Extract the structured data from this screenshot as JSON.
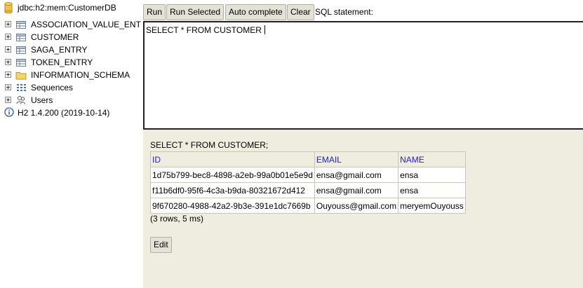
{
  "tree": {
    "connection": "jdbc:h2:mem:CustomerDB",
    "items": [
      {
        "label": "ASSOCIATION_VALUE_ENT",
        "icon": "table-icon"
      },
      {
        "label": "CUSTOMER",
        "icon": "table-icon"
      },
      {
        "label": "SAGA_ENTRY",
        "icon": "table-icon"
      },
      {
        "label": "TOKEN_ENTRY",
        "icon": "table-icon"
      },
      {
        "label": "INFORMATION_SCHEMA",
        "icon": "folder-icon"
      },
      {
        "label": "Sequences",
        "icon": "sequences-icon"
      },
      {
        "label": "Users",
        "icon": "users-icon"
      }
    ],
    "version": "H2 1.4.200 (2019-10-14)"
  },
  "toolbar": {
    "run": "Run",
    "run_selected": "Run Selected",
    "auto_complete": "Auto complete",
    "clear": "Clear",
    "sql_label": "SQL statement:"
  },
  "editor": {
    "sql": "SELECT * FROM CUSTOMER"
  },
  "result": {
    "statement": "SELECT * FROM CUSTOMER;",
    "columns": [
      "ID",
      "EMAIL",
      "NAME"
    ],
    "rows": [
      [
        "1d75b799-bec8-4898-a2eb-99a0b01e5e9d",
        "ensa@gmail.com",
        "ensa"
      ],
      [
        "f11b6df0-95f6-4c3a-b9da-80321672d412",
        "ensa@gmail.com",
        "ensa"
      ],
      [
        "9f670280-4988-42a2-9b3e-391e1dc7669b",
        "Ouyouss@gmail.com",
        "meryemOuyouss"
      ]
    ],
    "row_count": "(3 rows, 5 ms)",
    "edit": "Edit"
  },
  "colors": {
    "panel_bg": "#efece0",
    "header_text": "#2222cc",
    "button_bg": "#e4e2d6"
  }
}
